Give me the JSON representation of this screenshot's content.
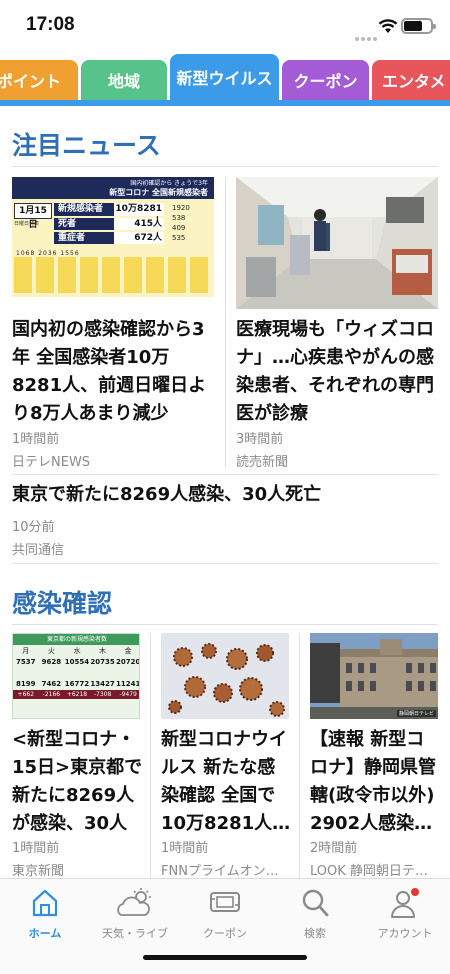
{
  "status": {
    "time": "17:08"
  },
  "tabs": [
    {
      "label": "ポイント",
      "color": "#f0a030"
    },
    {
      "label": "地域",
      "color": "#55c38a"
    },
    {
      "label": "新型ウイルス",
      "color": "#3b9be8"
    },
    {
      "label": "クーポン",
      "color": "#a45bd6"
    },
    {
      "label": "エンタメ",
      "color": "#e8555a"
    }
  ],
  "featured": {
    "title": "注目ニュース",
    "articles": [
      {
        "headline": "国内初の感染確認から3年 全国感染者10万8281人、前週日曜日より8万人あまり減少",
        "time": "1時間前",
        "source": "日テレNEWS"
      },
      {
        "headline": "医療現場も「ウィズコロナ」…心疾患やがんの感染患者、それぞれの専門医が診療",
        "time": "3時間前",
        "source": "読売新聞"
      },
      {
        "headline": "東京で新たに8269人感染、30人死亡",
        "time": "10分前",
        "source": "共同通信"
      }
    ],
    "thumb1": {
      "banner_small": "国内初確認から きょうで3年",
      "banner_large": "新型コロナ 全国新規感染者",
      "date": "1月15日",
      "date_sub": "日曜日発表",
      "rows": [
        {
          "label": "新規感染者",
          "value": "10万8281人"
        },
        {
          "label": "死者",
          "value": "415人"
        },
        {
          "label": "重症者",
          "value": "672人"
        }
      ],
      "side_numbers": [
        "1920",
        "538",
        "409",
        "535",
        "1068",
        "2036",
        "1556"
      ]
    }
  },
  "infections": {
    "title": "感染確認",
    "articles": [
      {
        "headline": "<新型コロナ・15日>東京都で新たに8269人が感染、30人死亡",
        "time": "1時間前",
        "source": "東京新聞"
      },
      {
        "headline": "新型コロナウイルス 新たな感染確認 全国で10万8281人…",
        "time": "1時間前",
        "source": "FNNプライムオン…"
      },
      {
        "headline": "【速報 新型コロナ】静岡県管轄(政令市以外) 2902人感染…",
        "time": "2時間前",
        "source": "LOOK 静岡朝日テ…"
      }
    ],
    "thumb1": {
      "header": "東京都の新規感染者数",
      "days": [
        "月",
        "火",
        "水",
        "木",
        "金"
      ],
      "row_a": [
        "7537",
        "9628",
        "10554",
        "20735",
        "20720"
      ],
      "row_b": [
        "8199",
        "7462",
        "16772",
        "13427",
        "11241"
      ],
      "diff": [
        "+662",
        "-2166",
        "+6218",
        "-7308",
        "-9479"
      ]
    },
    "thumb3_badge": "静岡朝日テレビ"
  },
  "nav": [
    {
      "label": "ホーム",
      "icon": "home-icon",
      "active": true
    },
    {
      "label": "天気・ライブ",
      "icon": "weather-icon",
      "active": false
    },
    {
      "label": "クーポン",
      "icon": "coupon-icon",
      "active": false
    },
    {
      "label": "検索",
      "icon": "search-icon",
      "active": false
    },
    {
      "label": "アカウント",
      "icon": "account-icon",
      "active": false
    }
  ],
  "colors": {
    "accent": "#2e6fb6",
    "nav_active": "#2e8fe0",
    "notification": "#e8352e"
  }
}
